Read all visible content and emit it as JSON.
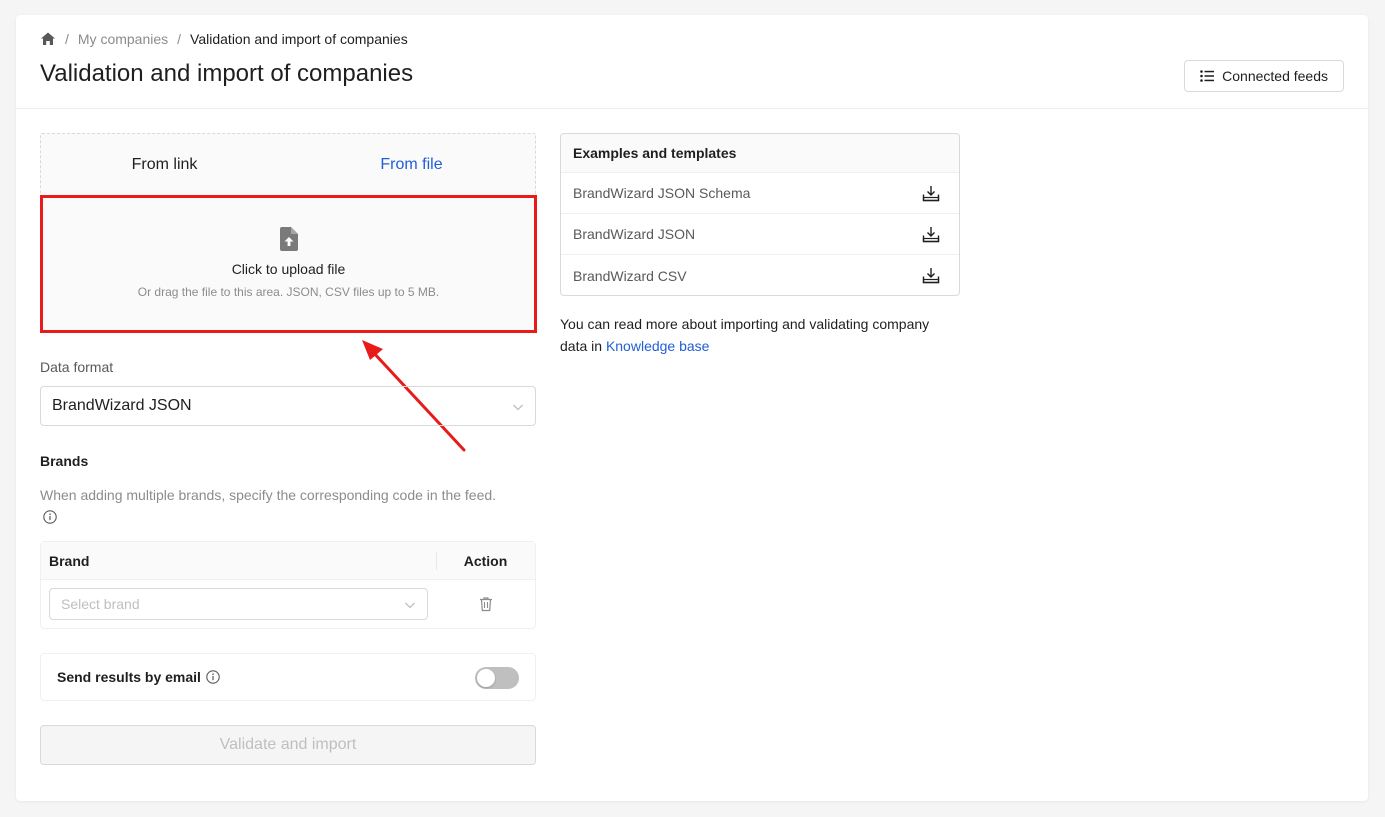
{
  "breadcrumb": {
    "home_icon": "home-icon",
    "parent": "My companies",
    "current": "Validation and import of companies",
    "separator": "/"
  },
  "page": {
    "title": "Validation and import of companies"
  },
  "header_actions": {
    "connected_feeds_label": "Connected feeds",
    "connected_feeds_icon": "list-icon"
  },
  "upload": {
    "tabs": [
      {
        "label": "From link",
        "active": false
      },
      {
        "label": "From file",
        "active": true
      }
    ],
    "drop_title": "Click to upload file",
    "drop_hint": "Or drag the file to this area. JSON, CSV files up to 5 MB.",
    "drop_icon": "file-upload-icon",
    "highlight_color": "#e81a1a"
  },
  "data_format": {
    "label": "Data format",
    "value": "BrandWizard JSON"
  },
  "brands": {
    "title": "Brands",
    "hint": "When adding multiple brands, specify the corresponding code in the feed.",
    "table": {
      "columns": [
        "Brand",
        "Action"
      ],
      "rows": [
        {
          "placeholder": "Select brand",
          "action_icon": "trash-icon"
        }
      ]
    }
  },
  "email": {
    "label": "Send results by email",
    "enabled": false
  },
  "validate_button": {
    "label": "Validate and import",
    "disabled": true
  },
  "examples": {
    "title": "Examples and templates",
    "items": [
      {
        "label": "BrandWizard JSON Schema",
        "icon": "download-icon"
      },
      {
        "label": "BrandWizard JSON",
        "icon": "download-icon"
      },
      {
        "label": "BrandWizard CSV",
        "icon": "download-icon"
      }
    ]
  },
  "read_more": {
    "text": "You can read more about importing and validating company data in ",
    "link_label": "Knowledge base"
  },
  "colors": {
    "accent": "#1f5fd6",
    "highlight": "#e81a1a"
  }
}
